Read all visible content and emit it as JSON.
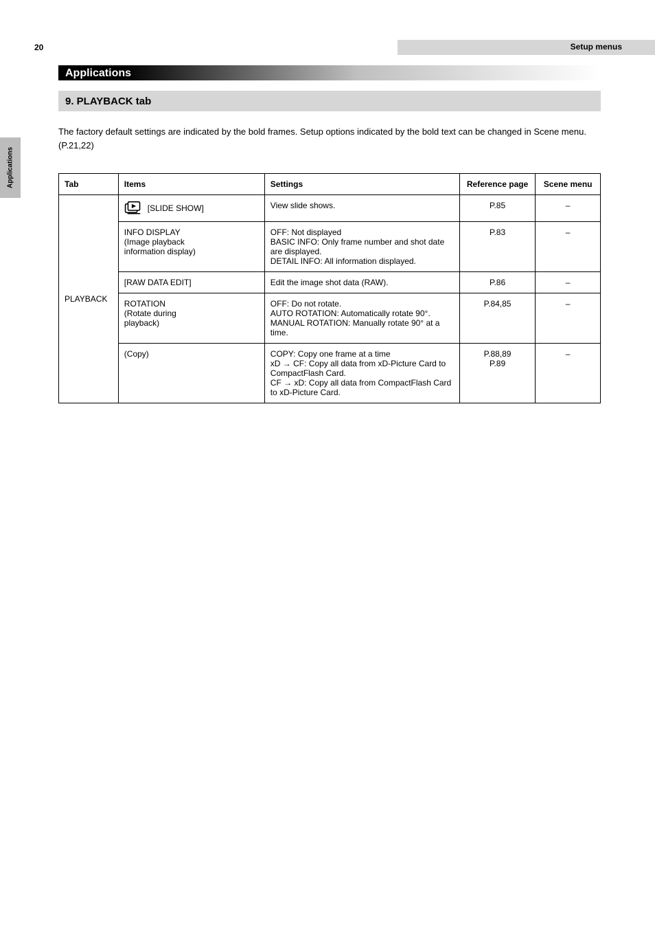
{
  "page_number": "20",
  "top_bar_text": "Setup menus",
  "app_title": "Applications",
  "subheader": "9. PLAYBACK tab",
  "intro": "The factory default settings are indicated by the bold frames. Setup options indicated by the bold text can be changed in Scene menu. (P.21,22)",
  "side_tab": "Applications",
  "table": {
    "headers": [
      "Tab",
      "Items",
      "Settings",
      "Reference page",
      "Scene menu"
    ],
    "c1_label": "PLAYBACK",
    "rows": [
      {
        "item_icon": true,
        "item_lines": [
          "[SLIDE SHOW]"
        ],
        "settings": [
          "View slide shows."
        ],
        "ref_lines": [
          "P.85"
        ],
        "scene": "–"
      },
      {
        "item_lines": [
          "INFO DISPLAY",
          "(Image playback",
          "information display)"
        ],
        "settings": [
          "OFF: Not displayed",
          "BASIC INFO: Only frame number and shot date are displayed.",
          "DETAIL INFO: All information displayed."
        ],
        "ref_lines": [
          "P.83"
        ],
        "scene": "–"
      },
      {
        "item_lines": [
          "[RAW DATA EDIT]"
        ],
        "settings": [
          "Edit the image shot data (RAW)."
        ],
        "ref_lines": [
          "P.86"
        ],
        "scene": "–"
      },
      {
        "item_lines": [
          "ROTATION",
          "(Rotate during",
          "playback)"
        ],
        "settings": [
          "OFF: Do not rotate.",
          "AUTO ROTATION: Automatically rotate 90°.",
          "MANUAL ROTATION: Manually rotate 90° at a time."
        ],
        "ref_lines": [
          "P.84,85"
        ],
        "scene": "–"
      },
      {
        "item_lines": [
          "(Copy)"
        ],
        "settings": [
          "COPY: Copy one frame at a time",
          "xD → CF: Copy all data from xD-Picture Card to CompactFlash Card.",
          "CF → xD: Copy all data from CompactFlash Card to xD-Picture Card."
        ],
        "ref_lines": [
          "P.88,89",
          "P.89"
        ],
        "scene": "–"
      }
    ]
  }
}
